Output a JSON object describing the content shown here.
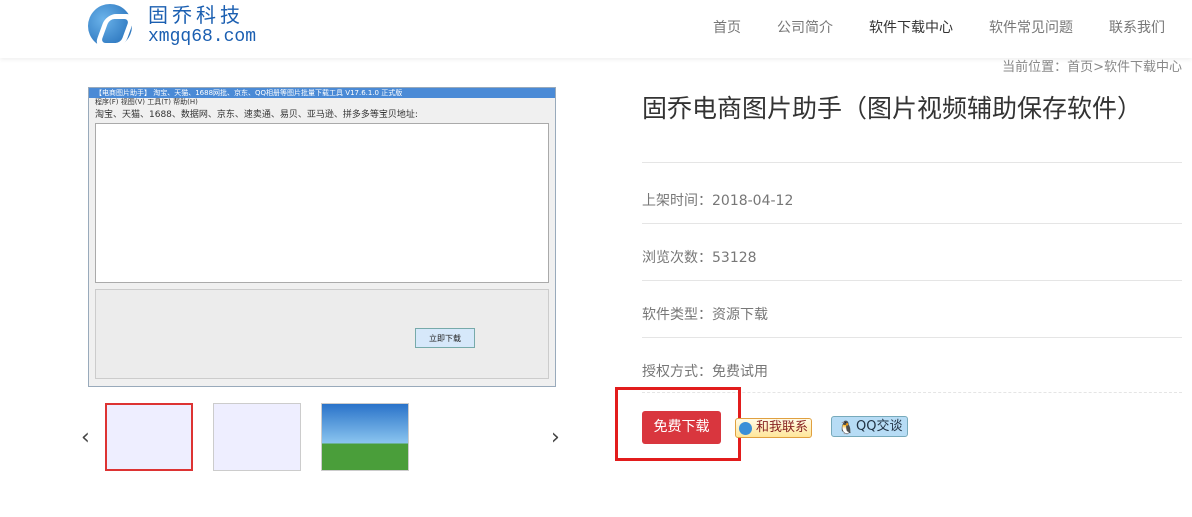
{
  "header": {
    "logo_cn": "固乔科技",
    "logo_en": "xmgq68.com",
    "nav": [
      "首页",
      "公司简介",
      "软件下载中心",
      "软件常见问题",
      "联系我们"
    ],
    "active": "软件下载中心"
  },
  "breadcrumb": "当前位置：首页>软件下载中心",
  "product": {
    "title": "固乔电商图片助手（图片视频辅助保存软件）",
    "release": "上架时间：2018-04-12",
    "views": "浏览次数：53128",
    "type": "软件类型：资源下载",
    "license": "授权方式：免费试用",
    "download": "免费下载",
    "contact": "和我联系",
    "qq": "QQ交谈"
  },
  "screenshot": {
    "title": "【电商图片助手】 淘宝、天猫、1688网批、京东、QQ相册等图片批量下载工具 V17.6.1.0 正式版",
    "menu": "程序(F)   视图(V)   工具(T)   帮助(H)",
    "sources": "淘宝、天猫、1688、数据网、京东、速卖通、易贝、亚马逊、拼多多等宝贝地址:",
    "start": "立即下载"
  }
}
